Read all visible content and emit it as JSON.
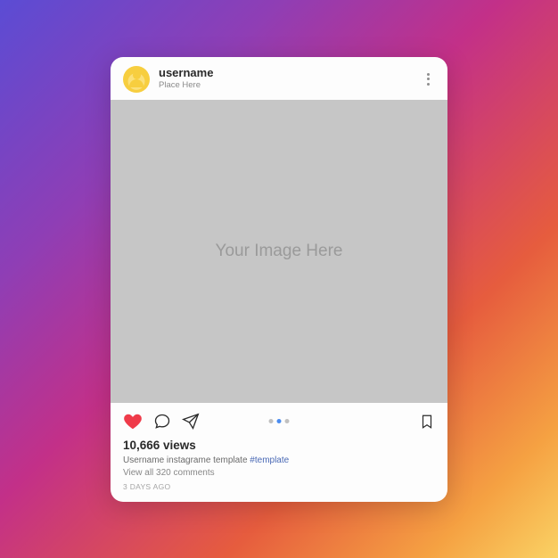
{
  "header": {
    "username": "username",
    "place": "Place Here"
  },
  "image": {
    "placeholder": "Your Image Here"
  },
  "stats": {
    "views": "10,666 views"
  },
  "caption": {
    "text": "Username instagrame template ",
    "hashtag": "#template"
  },
  "comments": {
    "link": "View all 320 comments"
  },
  "timestamp": "3 DAYS AGO"
}
